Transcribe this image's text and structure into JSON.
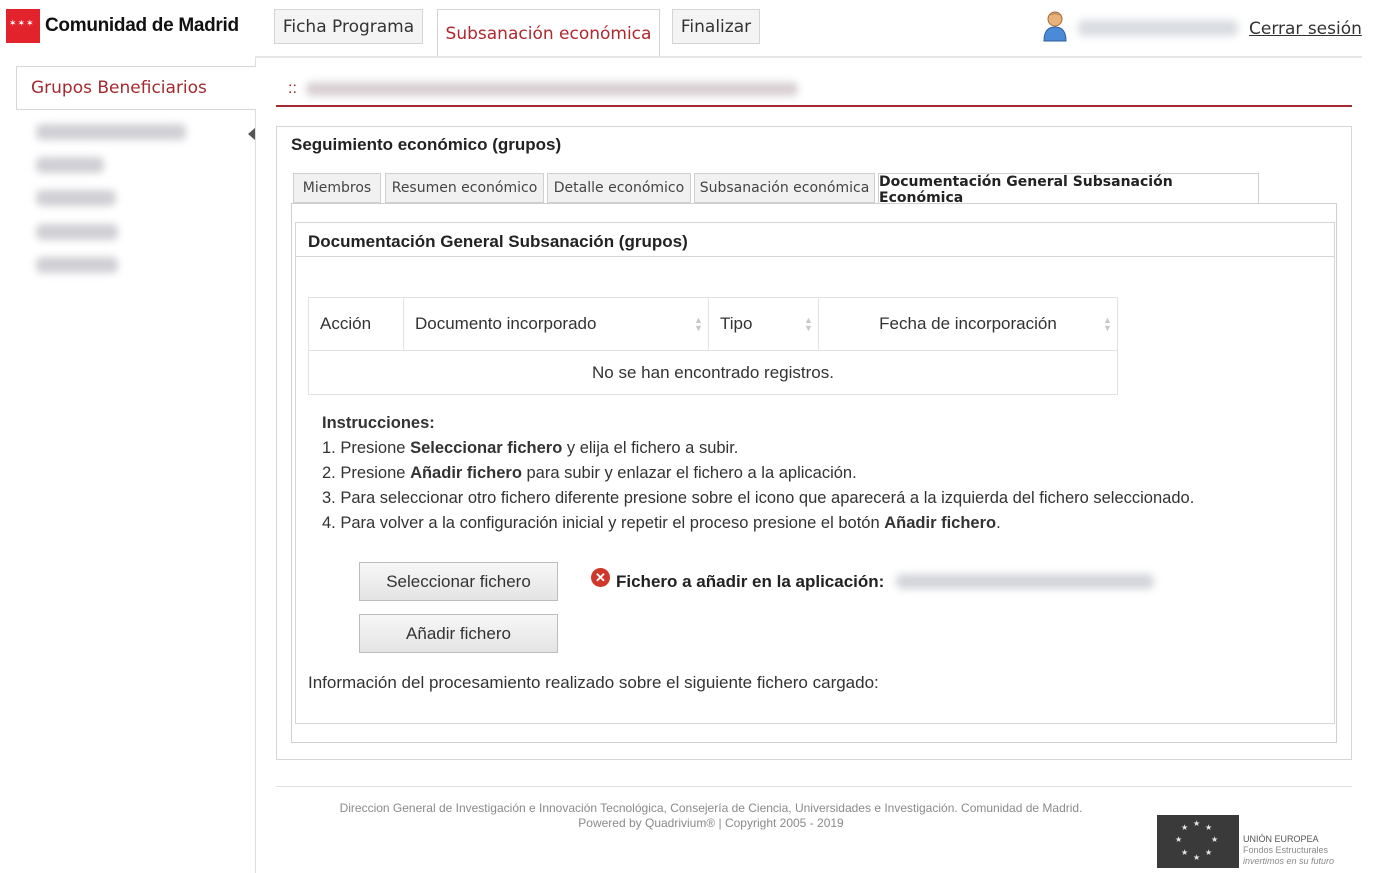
{
  "header": {
    "logo_text": "Comunidad de Madrid",
    "tabs": [
      {
        "label": "Ficha Programa",
        "active": false
      },
      {
        "label": "Subsanación económica",
        "active": true
      },
      {
        "label": "Finalizar",
        "active": false
      }
    ],
    "logout_label": "Cerrar sesión"
  },
  "sidebar": {
    "title": "Grupos Beneficiarios"
  },
  "breadcrumb": {
    "prefix": "::"
  },
  "panel": {
    "title": "Seguimiento económico (grupos)",
    "tabs": [
      {
        "label": "Miembros",
        "active": false
      },
      {
        "label": "Resumen económico",
        "active": false
      },
      {
        "label": "Detalle económico",
        "active": false
      },
      {
        "label": "Subsanación económica",
        "active": false
      },
      {
        "label": "Documentación General Subsanación Económica",
        "active": true
      }
    ],
    "inner_title": "Documentación General Subsanación (grupos)",
    "table": {
      "columns": [
        "Acción",
        "Documento incorporado",
        "Tipo",
        "Fecha de incorporación"
      ],
      "empty_message": "No se han encontrado registros."
    },
    "instructions": {
      "heading": "Instrucciones:",
      "step1_a": "1. Presione ",
      "step1_b": "Seleccionar fichero",
      "step1_c": " y elija el fichero a subir.",
      "step2_a": "2. Presione ",
      "step2_b": "Añadir fichero",
      "step2_c": " para subir y enlazar el fichero a la aplicación.",
      "step3": "3. Para seleccionar otro fichero diferente presione sobre el icono que aparecerá a la izquierda del fichero seleccionado.",
      "step4_a": "4. Para volver a la configuración inicial y repetir el proceso presione el botón ",
      "step4_b": "Añadir fichero",
      "step4_c": "."
    },
    "select_file_button": "Seleccionar fichero",
    "add_file_button": "Añadir fichero",
    "file_label": "Fichero a añadir en la aplicación:",
    "processing_info": "Información del procesamiento realizado sobre el siguiente fichero cargado:"
  },
  "footer": {
    "line1": "Direccion General de Investigación e Innovación Tecnológica, Consejería de Ciencia, Universidades e Investigación. Comunidad de Madrid.",
    "line2": "Powered by Quadrivium® | Copyright 2005 - 2019",
    "eu_line1": "UNIÓN EUROPEA",
    "eu_line2": "Fondos Estructurales",
    "eu_line3": "invertimos en su futuro"
  },
  "icons": {
    "user": "user-icon",
    "error": "error-remove-icon",
    "sort": "sort-arrows-icon",
    "collapse": "collapse-arrow-icon",
    "eu_flag": "eu-flag-icon"
  },
  "colors": {
    "brand_red": "#e3232b",
    "accent": "#a32a2f"
  }
}
